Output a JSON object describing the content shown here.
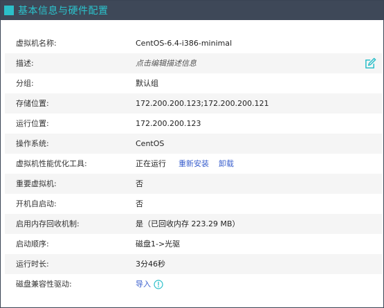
{
  "header": {
    "title": "基本信息与硬件配置"
  },
  "rows": [
    {
      "label": "虚拟机名称:",
      "value": "CentOS-6.4-i386-minimal"
    },
    {
      "label": "描述:",
      "value": "点击编辑描述信息"
    },
    {
      "label": "分组:",
      "value": "默认组"
    },
    {
      "label": "存储位置:",
      "value": "172.200.200.123;172.200.200.121"
    },
    {
      "label": "运行位置:",
      "value": "172.200.200.123"
    },
    {
      "label": "操作系统:",
      "value": "CentOS"
    },
    {
      "label": "虚拟机性能优化工具:",
      "value": "正在运行",
      "reinstall_label": "重新安装",
      "uninstall_label": "卸载"
    },
    {
      "label": "重要虚拟机:",
      "value": "否"
    },
    {
      "label": "开机自启动:",
      "value": "否"
    },
    {
      "label": "启用内存回收机制:",
      "value": "是（已回收内存 223.29 MB）"
    },
    {
      "label": "启动顺序:",
      "value": "磁盘1->光驱"
    },
    {
      "label": "运行时长:",
      "value": "3分46秒"
    },
    {
      "label": "磁盘兼容性驱动:",
      "value": "导入"
    }
  ],
  "icons": {
    "edit": "edit-icon",
    "info": "info-icon"
  },
  "colors": {
    "header_bg": "#3e4858",
    "accent": "#2bbfc9",
    "link": "#3a5fcd",
    "row_alt": "#f5f5f5"
  }
}
